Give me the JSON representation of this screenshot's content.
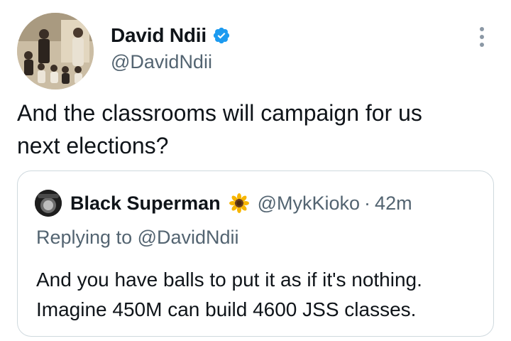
{
  "author": {
    "name": "David Ndii",
    "handle": "@DavidNdii",
    "verified_color": "#1d9bf0"
  },
  "tweet": {
    "text_line1": "And the classrooms will campaign for us",
    "text_line2": "next elections?"
  },
  "quote": {
    "name": "Black Superman",
    "name_emoji": "sunflower",
    "handle": "@MykKioko",
    "separator": "·",
    "time": "42m",
    "replying_prefix": "Replying to ",
    "replying_handle": "@DavidNdii",
    "text_line1": "And you have balls to put it as if it's nothing.",
    "text_line2": "Imagine 450M can build 4600 JSS classes."
  },
  "icons": {
    "verified": "verified-badge-icon",
    "more": "more-options-icon",
    "sunflower": "sunflower-emoji-icon"
  }
}
